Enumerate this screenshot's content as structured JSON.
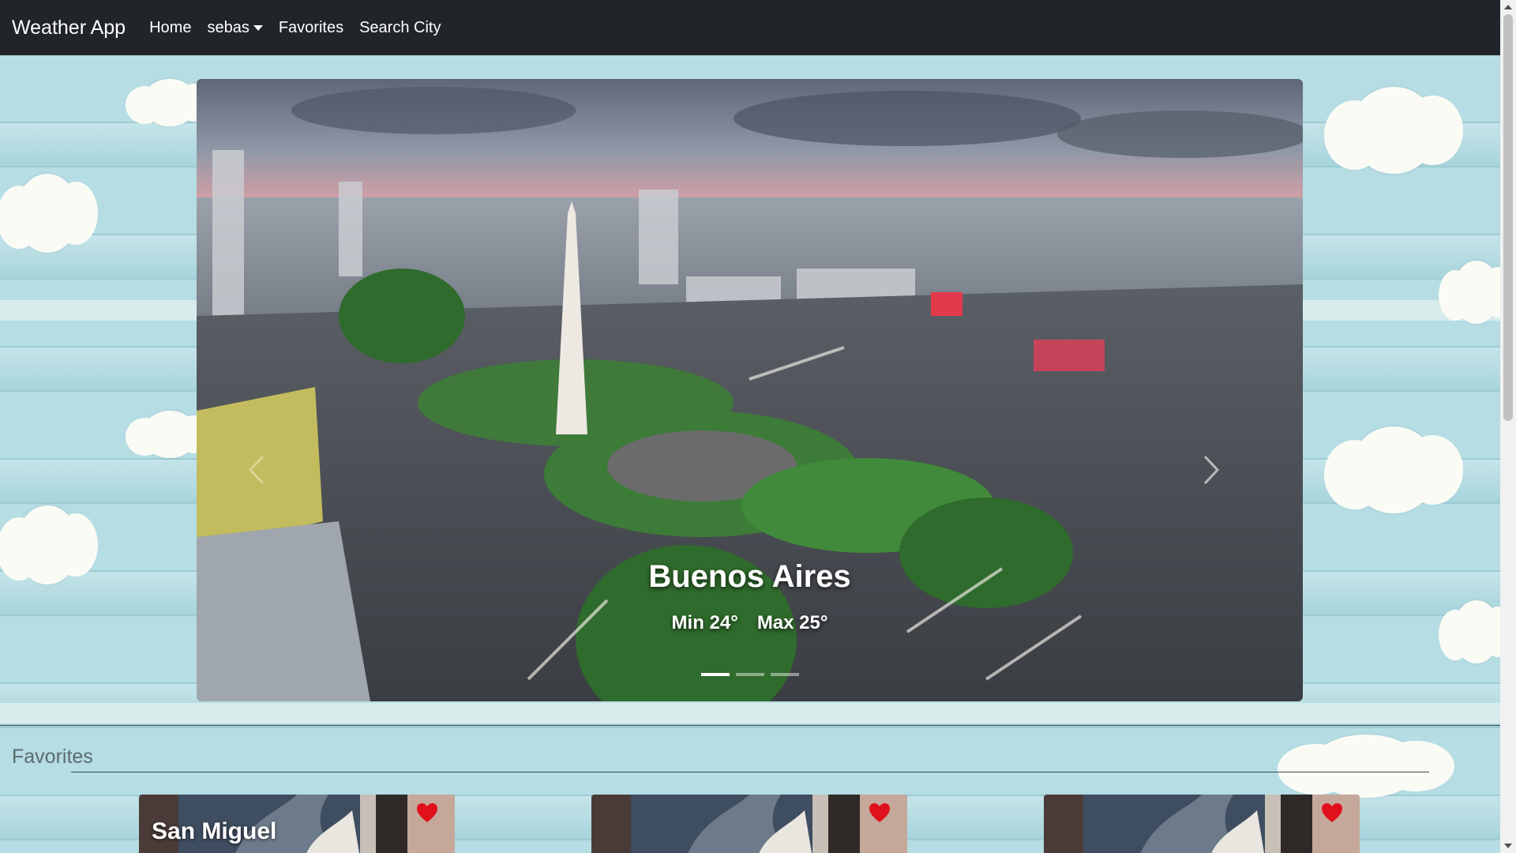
{
  "navbar": {
    "brand": "Weather App",
    "links": {
      "home": "Home",
      "user": "sebas",
      "favorites": "Favorites",
      "search": "Search City"
    }
  },
  "carousel": {
    "slide": {
      "city": "Buenos Aires",
      "min": "Min 24°",
      "max": "Max 25°"
    },
    "indicator_count": 3,
    "active_indicator": 1
  },
  "favorites": {
    "title": "Favorites",
    "cards": [
      {
        "name": "San Miguel"
      },
      {
        "name": ""
      },
      {
        "name": ""
      }
    ]
  },
  "colors": {
    "navbar_bg": "#212529",
    "heart": "#e0101c",
    "background": "#a9d3da"
  },
  "icons": {
    "heart": "heart-icon",
    "caret": "caret-down-icon",
    "next": "chevron-right-icon",
    "prev": "chevron-left-icon"
  }
}
